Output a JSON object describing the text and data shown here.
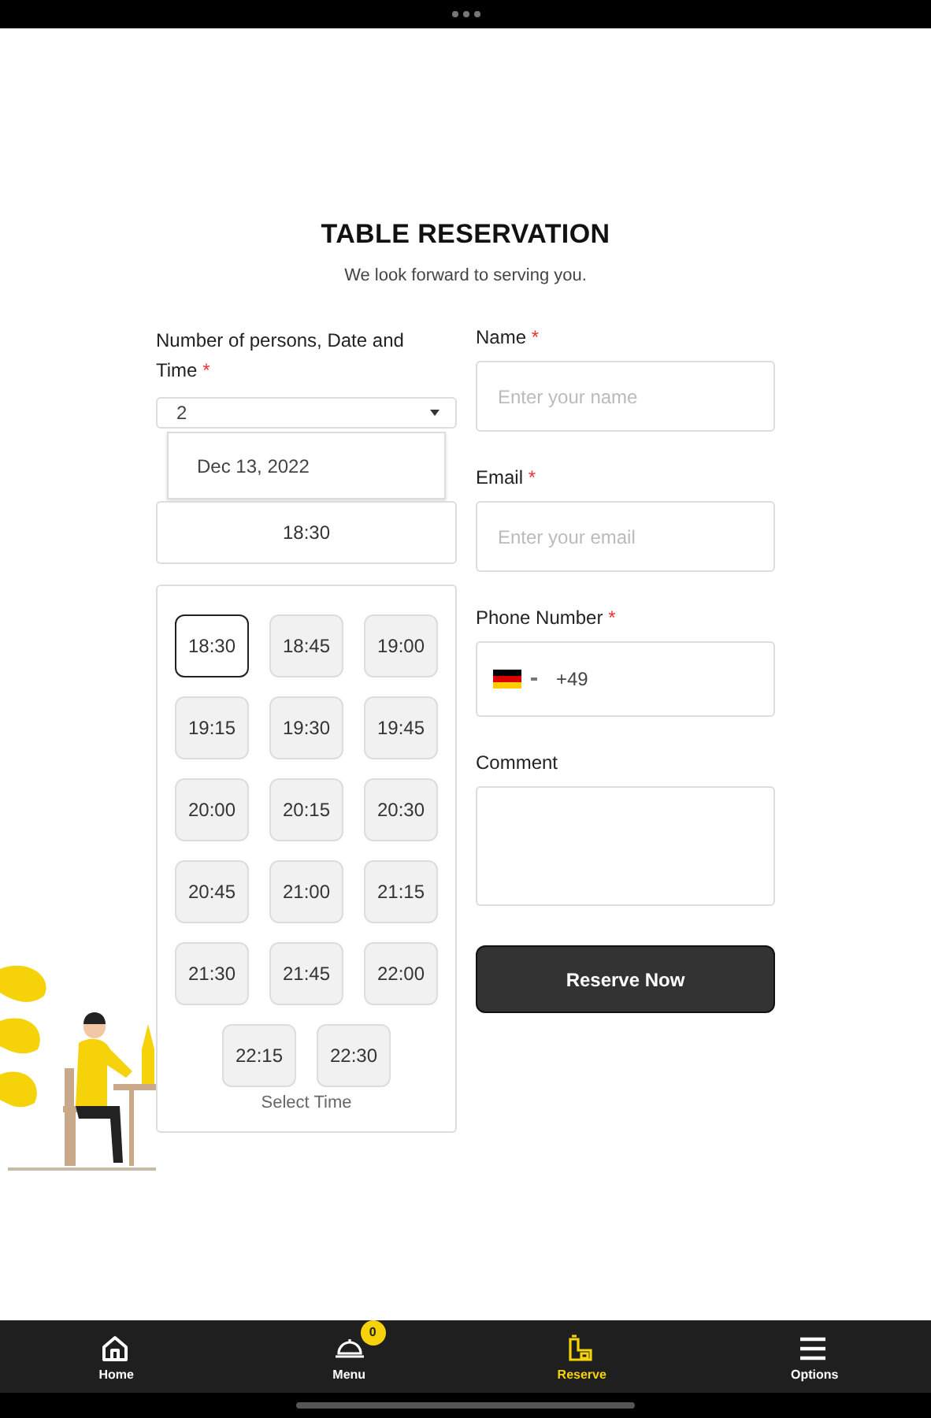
{
  "header": {
    "title": "TABLE RESERVATION",
    "subtitle": "We look forward to serving you."
  },
  "booking": {
    "label": "Number of persons, Date and Time",
    "mark": "*",
    "persons": "2",
    "date": "Dec 13, 2022",
    "time": "18:30",
    "slots": [
      {
        "time": "18:30",
        "selected": true
      },
      {
        "time": "18:45",
        "selected": false
      },
      {
        "time": "19:00",
        "selected": false
      },
      {
        "time": "19:15",
        "selected": false
      },
      {
        "time": "19:30",
        "selected": false
      },
      {
        "time": "19:45",
        "selected": false
      },
      {
        "time": "20:00",
        "selected": false
      },
      {
        "time": "20:15",
        "selected": false
      },
      {
        "time": "20:30",
        "selected": false
      },
      {
        "time": "20:45",
        "selected": false
      },
      {
        "time": "21:00",
        "selected": false
      },
      {
        "time": "21:15",
        "selected": false
      },
      {
        "time": "21:30",
        "selected": false
      },
      {
        "time": "21:45",
        "selected": false
      },
      {
        "time": "22:00",
        "selected": false
      },
      {
        "time": "22:15",
        "selected": false
      },
      {
        "time": "22:30",
        "selected": false
      }
    ],
    "caption": "Select Time"
  },
  "fields": [
    {
      "kind": "text",
      "label": "Name",
      "mark": "*",
      "placeholder": "Enter your name"
    },
    {
      "kind": "text",
      "label": "Email",
      "mark": "*",
      "placeholder": "Enter your email"
    },
    {
      "kind": "phone",
      "label": "Phone Number",
      "mark": "*",
      "value": "+49"
    },
    {
      "kind": "textarea",
      "label": "Comment"
    }
  ],
  "submit": "Reserve Now",
  "nav": [
    {
      "kind": "home",
      "label": "Home",
      "selected": false
    },
    {
      "kind": "menu",
      "label": "Menu",
      "badge": "0",
      "selected": false
    },
    {
      "kind": "reserve",
      "label": "Reserve",
      "selected": true
    },
    {
      "kind": "options",
      "label": "Options",
      "selected": false
    }
  ]
}
